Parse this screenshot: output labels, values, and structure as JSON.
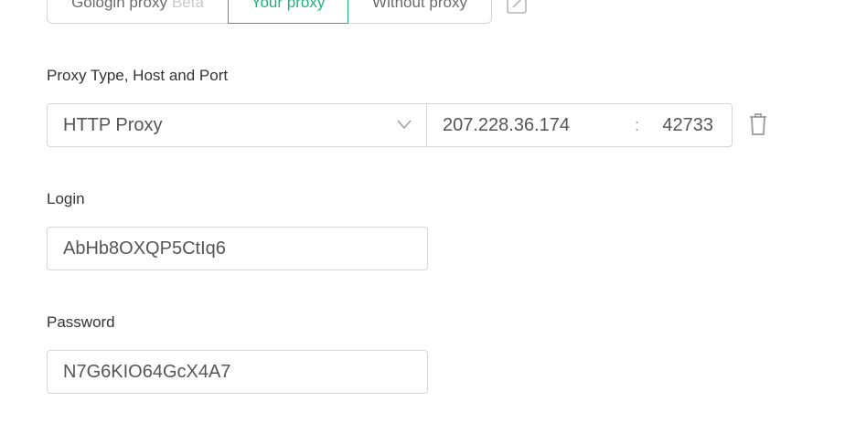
{
  "proxy_mode": {
    "options": [
      {
        "label": "Gologin proxy",
        "badge": "Beta"
      },
      {
        "label": "Your proxy"
      },
      {
        "label": "Without proxy"
      }
    ],
    "selected": "Your proxy"
  },
  "proxy": {
    "section_label": "Proxy Type, Host and Port",
    "type": "HTTP Proxy",
    "host": "207.228.36.174",
    "separator": ":",
    "port": "42733"
  },
  "login": {
    "label": "Login",
    "value": "AbHb8OXQP5CtIq6"
  },
  "password": {
    "label": "Password",
    "value": "N7G6KIO64GcX4A7"
  },
  "colors": {
    "accent": "#1fb37a",
    "border": "#d5d5d5"
  },
  "icons": [
    "edit-icon",
    "chevron-down-icon",
    "trash-icon"
  ]
}
